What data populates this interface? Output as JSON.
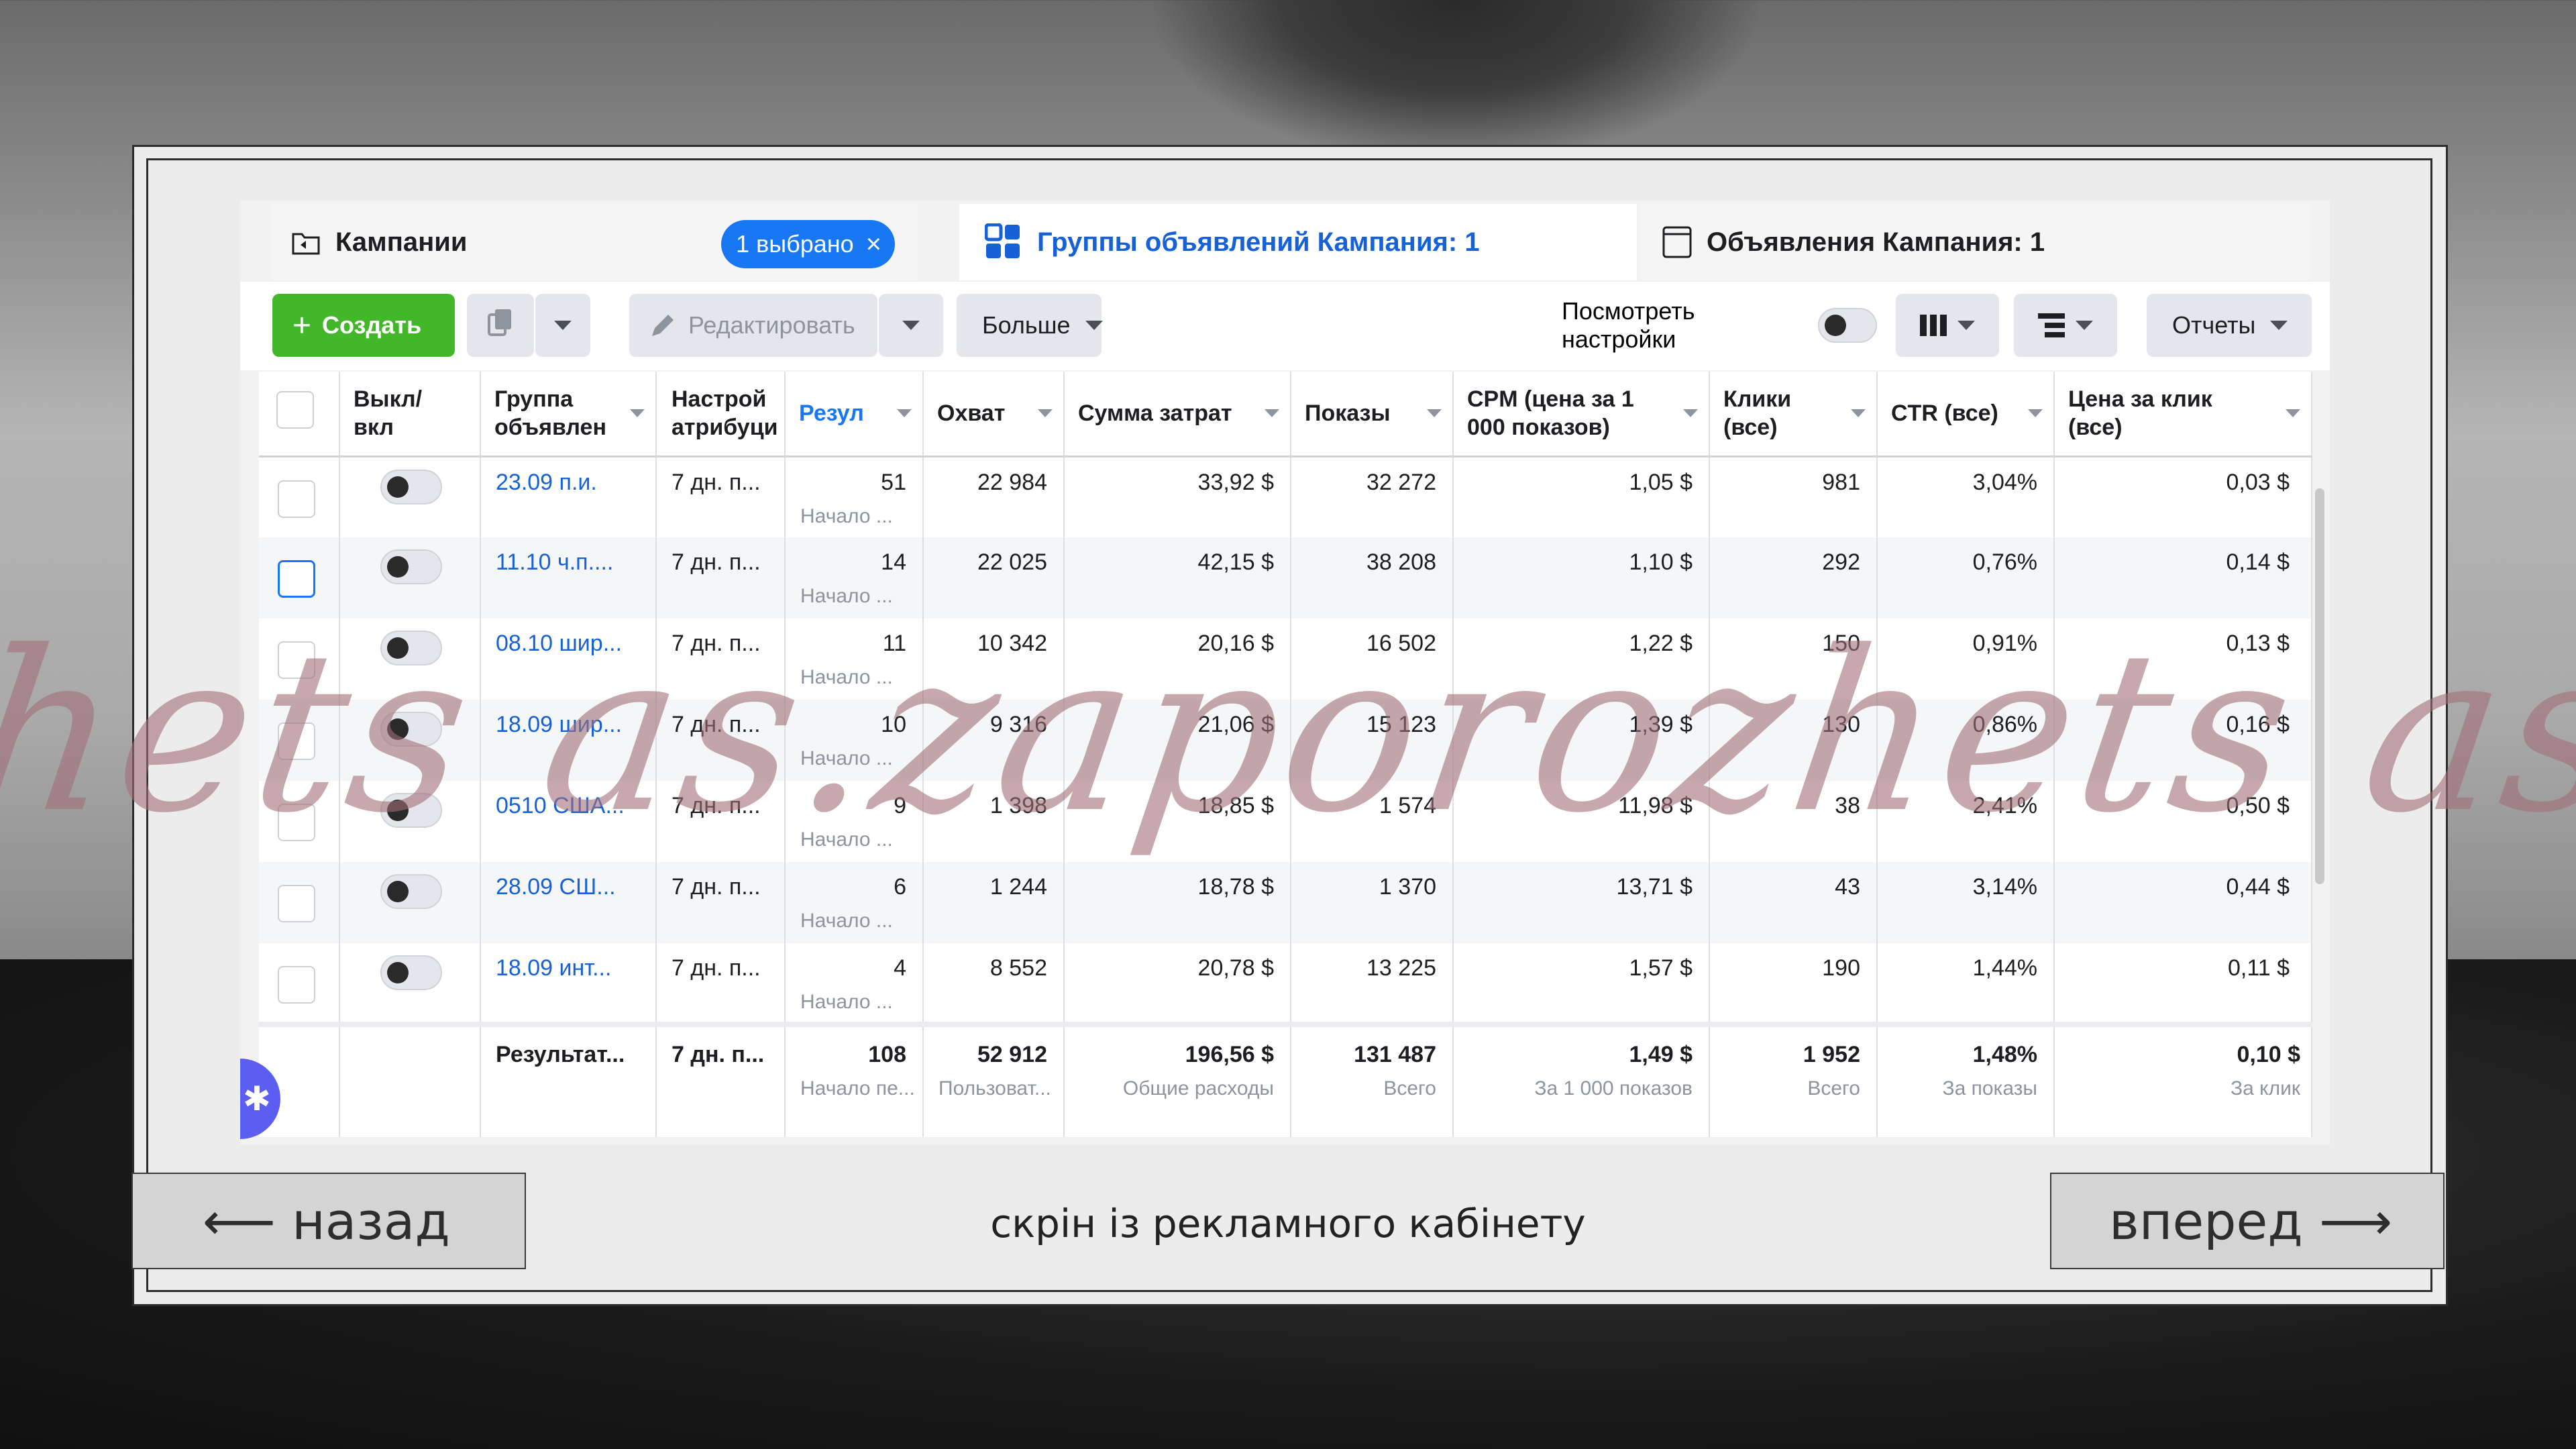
{
  "tabs": {
    "campaigns": {
      "label": "Кампании",
      "selected_badge": "1 выбрано",
      "close": "×"
    },
    "adsets": {
      "label": "Группы объявлений Кампания: 1"
    },
    "ads": {
      "label": "Объявления Кампания: 1"
    }
  },
  "toolbar": {
    "create_label": "Создать",
    "create_plus": "+",
    "edit_label": "Редактировать",
    "more_label": "Больше",
    "view_settings_label": "Посмотреть настройки",
    "reports_label": "Отчеты"
  },
  "table": {
    "headers": {
      "toggle": "Выкл/ вкл",
      "adset": "Группа объявлен",
      "attribution": "Настрой атрибуци",
      "results": "Резул",
      "reach": "Охват",
      "spend": "Сумма затрат",
      "impressions": "Показы",
      "cpm": "CPM (цена за 1 000 показов)",
      "clicks": "Клики (все)",
      "ctr": "CTR (все)",
      "cpc": "Цена за клик (все)"
    },
    "rows": [
      {
        "name": "23.09 п.и.",
        "attribution": "7 дн. п...",
        "results": "51",
        "results_sub": "Начало ...",
        "reach": "22 984",
        "spend": "33,92 $",
        "impressions": "32 272",
        "cpm": "1,05 $",
        "clicks": "981",
        "ctr": "3,04%",
        "cpc": "0,03 $"
      },
      {
        "name": "11.10 ч.п....",
        "attribution": "7 дн. п...",
        "results": "14",
        "results_sub": "Начало ...",
        "reach": "22 025",
        "spend": "42,15 $",
        "impressions": "38 208",
        "cpm": "1,10 $",
        "clicks": "292",
        "ctr": "0,76%",
        "cpc": "0,14 $"
      },
      {
        "name": "08.10 шир...",
        "attribution": "7 дн. п...",
        "results": "11",
        "results_sub": "Начало ...",
        "reach": "10 342",
        "spend": "20,16 $",
        "impressions": "16 502",
        "cpm": "1,22 $",
        "clicks": "150",
        "ctr": "0,91%",
        "cpc": "0,13 $"
      },
      {
        "name": "18.09 шир...",
        "attribution": "7 дн. п...",
        "results": "10",
        "results_sub": "Начало ...",
        "reach": "9 316",
        "spend": "21,06 $",
        "impressions": "15 123",
        "cpm": "1,39 $",
        "clicks": "130",
        "ctr": "0,86%",
        "cpc": "0,16 $"
      },
      {
        "name": "0510 США...",
        "attribution": "7 дн. п...",
        "results": "9",
        "results_sub": "Начало ...",
        "reach": "1 398",
        "spend": "18,85 $",
        "impressions": "1 574",
        "cpm": "11,98 $",
        "clicks": "38",
        "ctr": "2,41%",
        "cpc": "0,50 $"
      },
      {
        "name": "28.09 СШ...",
        "attribution": "7 дн. п...",
        "results": "6",
        "results_sub": "Начало ...",
        "reach": "1 244",
        "spend": "18,78 $",
        "impressions": "1 370",
        "cpm": "13,71 $",
        "clicks": "43",
        "ctr": "3,14%",
        "cpc": "0,44 $"
      },
      {
        "name": "18.09 инт...",
        "attribution": "7 дн. п...",
        "results": "4",
        "results_sub": "Начало ...",
        "reach": "8 552",
        "spend": "20,78 $",
        "impressions": "13 225",
        "cpm": "1,57 $",
        "clicks": "190",
        "ctr": "1,44%",
        "cpc": "0,11 $"
      }
    ],
    "totals": {
      "name": "Результат...",
      "attribution": "7 дн. п...",
      "results": "108",
      "results_sub": "Начало пе...",
      "reach": "52 912",
      "reach_sub": "Пользоват...",
      "spend": "196,56 $",
      "spend_sub": "Общие расходы",
      "impressions": "131 487",
      "impressions_sub": "Всего",
      "cpm": "1,49 $",
      "cpm_sub": "За 1 000 показов",
      "clicks": "1 952",
      "clicks_sub": "Всего",
      "ctr": "1,48%",
      "ctr_sub": "За показы",
      "cpc": "0,10 $",
      "cpc_sub": "За клик"
    }
  },
  "watermark": "hets as.zaporozhets as.zaporozhets as.z",
  "navigation": {
    "back_label": "⟵ назад",
    "forward_label": "вперед ⟶",
    "caption": "скрін із рекламного кабінету"
  },
  "colors": {
    "accent_blue": "#1877f2",
    "create_green": "#42b72a",
    "link_blue": "#1761d6",
    "watermark": "#a06e78"
  }
}
